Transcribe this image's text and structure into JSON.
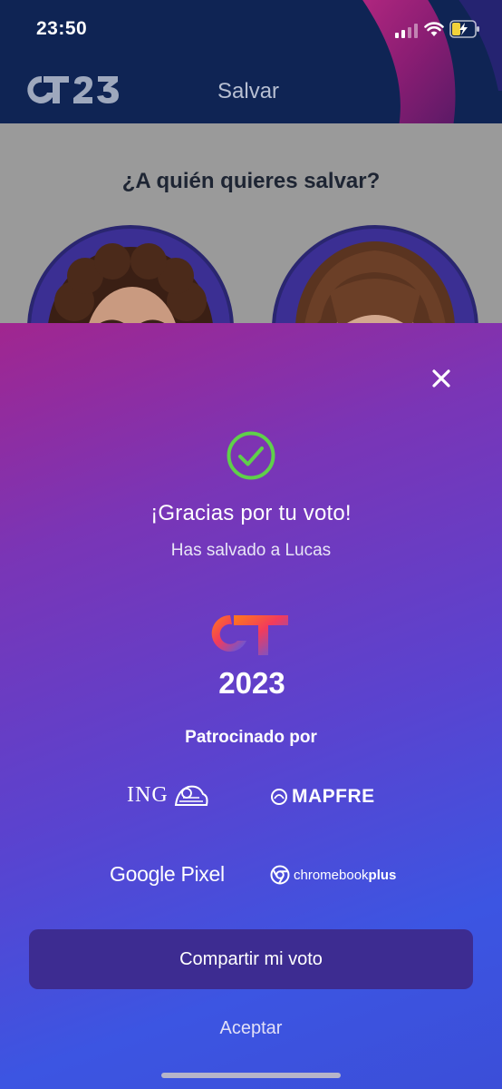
{
  "status_bar": {
    "time": "23:50"
  },
  "header": {
    "logo_text": "OT23",
    "title": "Salvar"
  },
  "main": {
    "question": "¿A quién quieres salvar?"
  },
  "modal": {
    "title": "¡Gracias por tu voto!",
    "subtitle": "Has salvado a Lucas",
    "logo_year": "2023",
    "sponsors_label": "Patrocinado por",
    "sponsors": {
      "ing": "ING",
      "mapfre": "MAPFRE",
      "google_pixel": "Google Pixel",
      "chromebook_regular": "chromebook",
      "chromebook_bold": "plus"
    },
    "share_label": "Compartir mi voto",
    "accept_label": "Aceptar"
  },
  "colors": {
    "header_bg": "#0f2454",
    "check_green": "#5fd04a",
    "share_button": "#3d2c91"
  }
}
